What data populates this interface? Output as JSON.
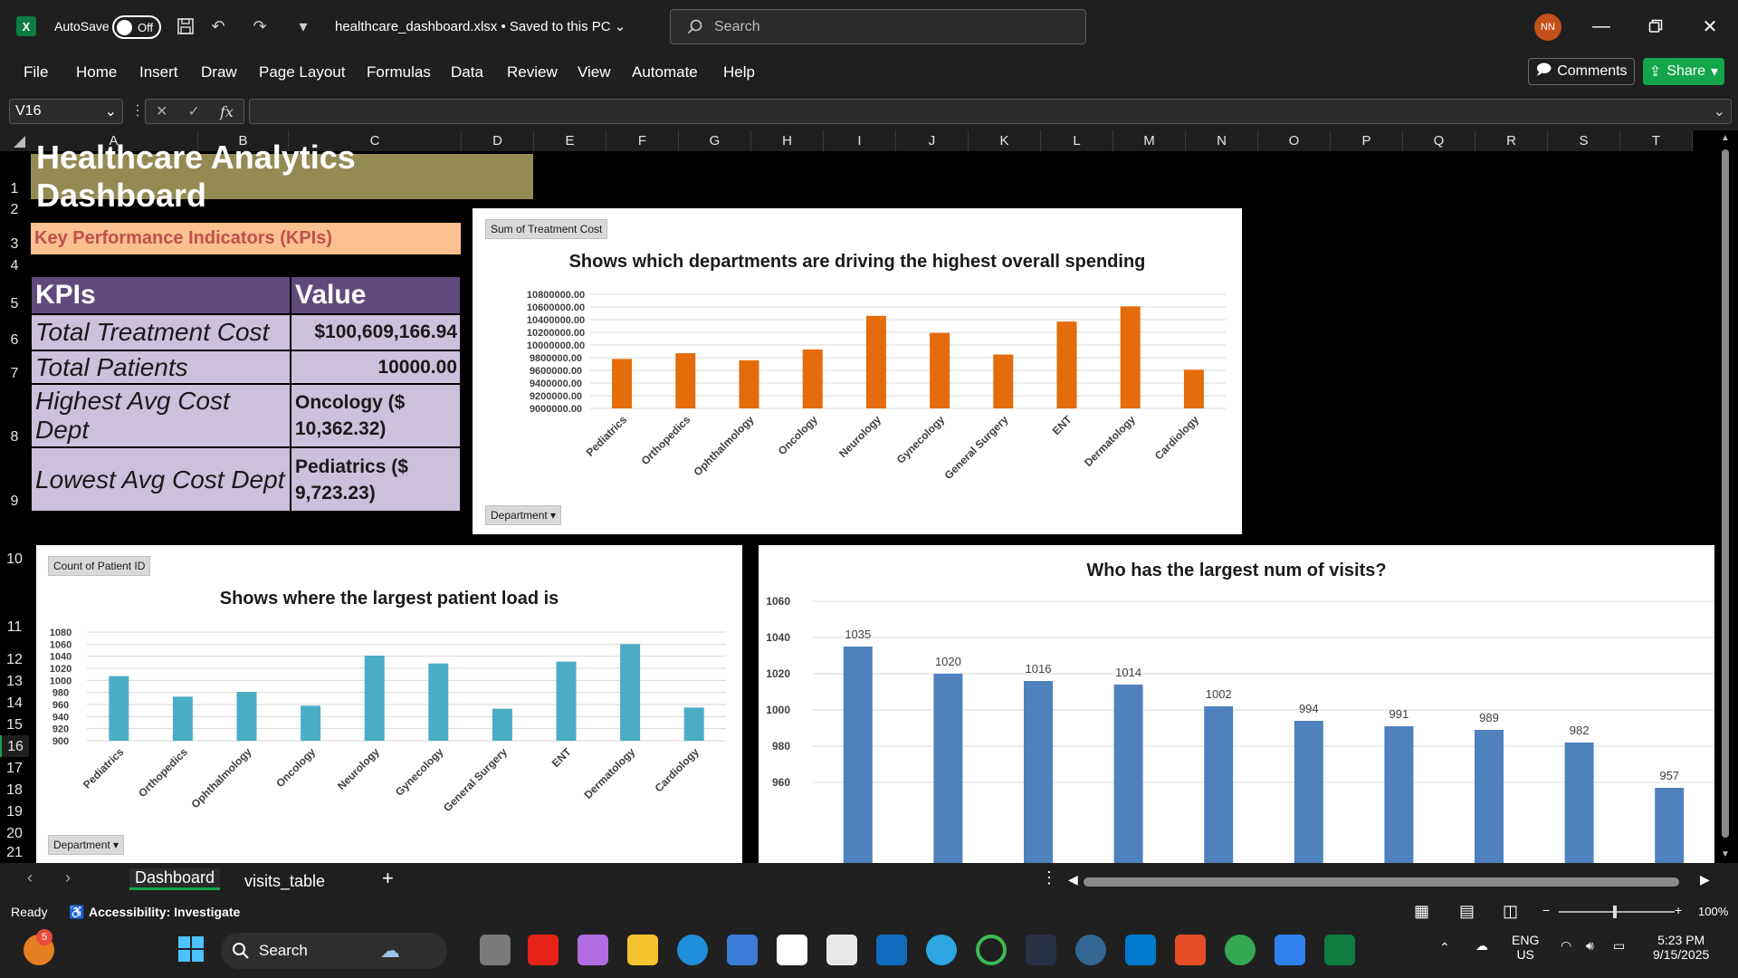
{
  "titlebar": {
    "autosave_label": "AutoSave",
    "autosave_state": "Off",
    "filename": "healthcare_dashboard.xlsx",
    "save_status": "Saved to this PC",
    "search_placeholder": "Search",
    "avatar_initials": "NN"
  },
  "menu": [
    "File",
    "Home",
    "Insert",
    "Draw",
    "Page Layout",
    "Formulas",
    "Data",
    "Review",
    "View",
    "Automate",
    "Help"
  ],
  "actions": {
    "comments": "Comments",
    "share": "Share"
  },
  "formula_bar": {
    "name_box": "V16",
    "fx": "fx",
    "formula": ""
  },
  "columns": [
    "A",
    "B",
    "C",
    "D",
    "E",
    "F",
    "G",
    "H",
    "I",
    "J",
    "K",
    "L",
    "M",
    "N",
    "O",
    "P",
    "Q",
    "R",
    "S",
    "T"
  ],
  "rows": [
    "1",
    "2",
    "3",
    "4",
    "5",
    "6",
    "7",
    "8",
    "9",
    "10",
    "11",
    "12",
    "13",
    "14",
    "15",
    "16",
    "17",
    "18",
    "19",
    "20",
    "21"
  ],
  "sheet": {
    "title": "Healthcare Analytics Dashboard",
    "kpi_section": "Key Performance Indicators (KPIs)",
    "kpi_headers": [
      "KPIs",
      "Value"
    ],
    "kpis": [
      {
        "label": "Total Treatment Cost",
        "value": "$100,609,166.94"
      },
      {
        "label": "Total Patients",
        "value": "10000.00"
      },
      {
        "label": "Highest Avg Cost Dept",
        "value": "Oncology ($ 10,362.32)"
      },
      {
        "label": "Lowest Avg Cost Dept",
        "value": "Pediatrics ($ 9,723.23)"
      }
    ]
  },
  "chart_data": [
    {
      "type": "bar",
      "pivot_field": "Sum of Treatment Cost",
      "axis_field": "Department",
      "title": "Shows which departments are driving the highest overall spending",
      "categories": [
        "Pediatrics",
        "Orthopedics",
        "Ophthalmology",
        "Oncology",
        "Neurology",
        "Gynecology",
        "General Surgery",
        "ENT",
        "Dermatology",
        "Cardiology"
      ],
      "values": [
        9780000,
        9870000,
        9760000,
        9930000,
        10460000,
        10190000,
        9850000,
        10370000,
        10610000,
        9610000
      ],
      "ylim": [
        9000000,
        10800000
      ],
      "yticks": [
        "10800000.00",
        "10600000.00",
        "10400000.00",
        "10200000.00",
        "10000000.00",
        "9800000.00",
        "9600000.00",
        "9400000.00",
        "9200000.00",
        "9000000.00"
      ],
      "color": "#e46c0a"
    },
    {
      "type": "bar",
      "pivot_field": "Count of Patient ID",
      "axis_field": "Department",
      "title": "Shows where the largest patient load is",
      "categories": [
        "Pediatrics",
        "Orthopedics",
        "Ophthalmology",
        "Oncology",
        "Neurology",
        "Gynecology",
        "General Surgery",
        "ENT",
        "Dermatology",
        "Cardiology"
      ],
      "values": [
        1007,
        973,
        981,
        958,
        1041,
        1028,
        953,
        1031,
        1060,
        955
      ],
      "ylim": [
        900,
        1080
      ],
      "yticks": [
        "1080",
        "1060",
        "1040",
        "1020",
        "1000",
        "980",
        "960",
        "940",
        "920",
        "900"
      ],
      "color": "#4bacc6"
    },
    {
      "type": "bar",
      "title": "Who has the largest num of visits?",
      "values": [
        1035,
        1020,
        1016,
        1014,
        1002,
        994,
        991,
        989,
        982,
        957
      ],
      "labels": [
        "1035",
        "1020",
        "1016",
        "1014",
        "1002",
        "994",
        "991",
        "989",
        "982",
        "957"
      ],
      "ylim": [
        950,
        1060
      ],
      "yticks": [
        "1060",
        "1040",
        "1020",
        "1000",
        "980",
        "960"
      ],
      "color": "#4f81bd"
    }
  ],
  "sheet_tabs": [
    "Dashboard",
    "visits_table"
  ],
  "status": {
    "ready": "Ready",
    "accessibility": "Accessibility: Investigate",
    "zoom": "100%"
  },
  "taskbar": {
    "search": "Search",
    "lang1": "ENG",
    "lang2": "US",
    "time": "5:23 PM",
    "date": "9/15/2025",
    "badge": "5"
  }
}
